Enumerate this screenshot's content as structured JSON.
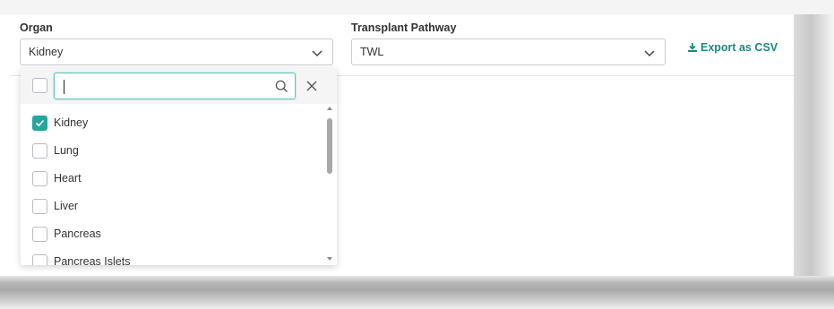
{
  "filters": {
    "organ": {
      "label": "Organ",
      "value": "Kidney"
    },
    "pathway": {
      "label": "Transplant Pathway",
      "value": "TWL"
    },
    "export_label": "Export as CSV"
  },
  "dropdown": {
    "search_value": "",
    "options": [
      {
        "label": "Kidney",
        "checked": true
      },
      {
        "label": "Lung",
        "checked": false
      },
      {
        "label": "Heart",
        "checked": false
      },
      {
        "label": "Liver",
        "checked": false
      },
      {
        "label": "Pancreas",
        "checked": false
      },
      {
        "label": "Pancreas Islets",
        "checked": false
      }
    ]
  },
  "colors": {
    "accent": "#26a69a",
    "export_text": "#1a8a7e",
    "search_focus_border": "#5cc8c0"
  },
  "icons": {
    "chevron": "chevron-down-icon",
    "search": "search-icon",
    "close": "close-icon",
    "download": "download-icon",
    "check": "check-icon"
  }
}
